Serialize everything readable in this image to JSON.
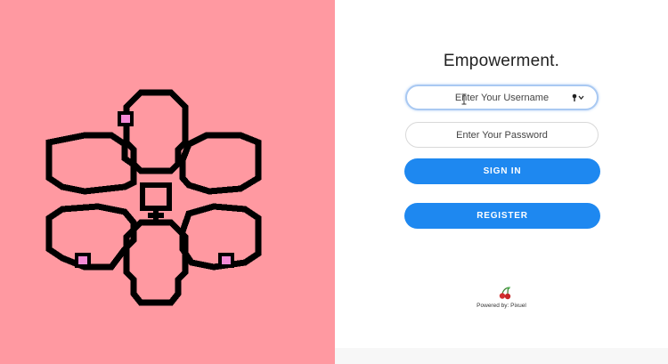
{
  "brand": {
    "title": "Empowerment."
  },
  "form": {
    "username_placeholder": "Enter Your Username",
    "password_placeholder": "Enter Your Password",
    "signin_label": "SIGN IN",
    "register_label": "REGISTER"
  },
  "footer": {
    "powered_by": "Powered by: Pixuel"
  },
  "icons": {
    "key": "key-icon",
    "cherry": "cherry-icon",
    "logo": "venus-flower-icon"
  },
  "colors": {
    "left_bg": "#ff99a1",
    "accent": "#1e88f0",
    "pixel_pink": "#f58ad6"
  }
}
